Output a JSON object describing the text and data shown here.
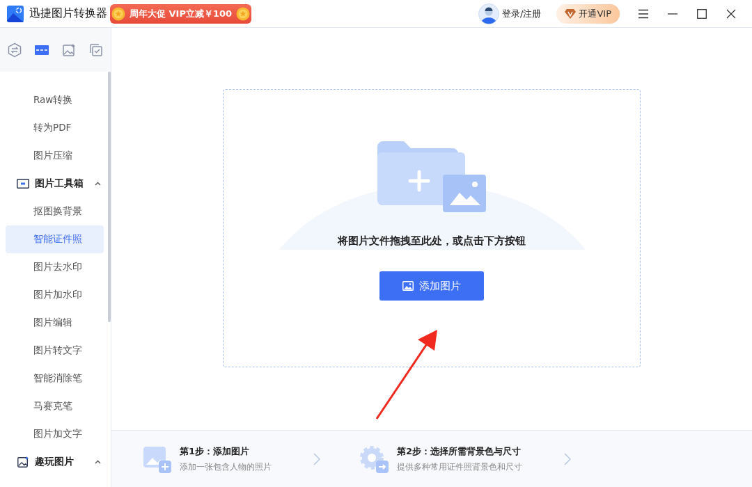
{
  "app": {
    "title": "迅捷图片转换器",
    "promo": "周年大促 VIP立减￥100",
    "login": "登录/注册",
    "vip": "开通VIP"
  },
  "sidebar": {
    "tabs": [
      {
        "selected": false
      },
      {
        "selected": true
      },
      {
        "selected": false
      },
      {
        "selected": false
      }
    ],
    "items": [
      {
        "kind": "item",
        "label": "Raw转换",
        "selected": false
      },
      {
        "kind": "item",
        "label": "转为PDF",
        "selected": false
      },
      {
        "kind": "item",
        "label": "图片压缩",
        "selected": false
      },
      {
        "kind": "group",
        "label": "图片工具箱",
        "expanded": true
      },
      {
        "kind": "item",
        "label": "抠图换背景",
        "selected": false
      },
      {
        "kind": "item",
        "label": "智能证件照",
        "selected": true
      },
      {
        "kind": "item",
        "label": "图片去水印",
        "selected": false
      },
      {
        "kind": "item",
        "label": "图片加水印",
        "selected": false
      },
      {
        "kind": "item",
        "label": "图片编辑",
        "selected": false
      },
      {
        "kind": "item",
        "label": "图片转文字",
        "selected": false
      },
      {
        "kind": "item",
        "label": "智能消除笔",
        "selected": false
      },
      {
        "kind": "item",
        "label": "马赛克笔",
        "selected": false
      },
      {
        "kind": "item",
        "label": "图片加文字",
        "selected": false
      },
      {
        "kind": "group",
        "label": "趣玩图片",
        "expanded": true
      }
    ]
  },
  "drop": {
    "hint": "将图片文件拖拽至此处，或点击下方按钮",
    "button": "添加图片"
  },
  "steps": [
    {
      "title": "第1步：添加图片",
      "desc": "添加一张包含人物的照片"
    },
    {
      "title": "第2步：选择所需背景色与尺寸",
      "desc": "提供多种常用证件照背景色和尺寸"
    }
  ]
}
